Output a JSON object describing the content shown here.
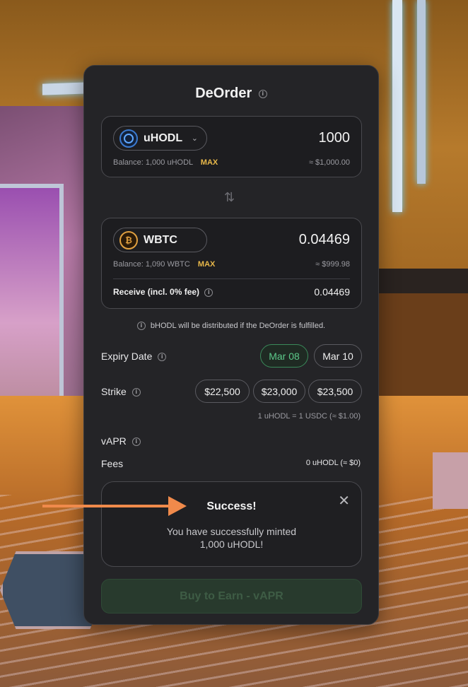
{
  "header": {
    "title": "DeOrder"
  },
  "from_token": {
    "symbol": "uHODL",
    "icon": "uhodl-token-icon",
    "amount": "1000",
    "balance": "Balance: 1,000 uHODL",
    "max_label": "MAX",
    "usd_value": "≈ $1,000.00"
  },
  "to_token": {
    "symbol": "WBTC",
    "icon": "bitcoin-token-icon",
    "amount": "0.04469",
    "balance": "Balance: 1,090 WBTC",
    "max_label": "MAX",
    "usd_value": "≈ $999.98",
    "receive_label": "Receive (incl. 0% fee)",
    "receive_value": "0.04469"
  },
  "notice": "bHODL will be distributed if the DeOrder is fulfilled.",
  "expiry": {
    "label": "Expiry Date",
    "options": [
      "Mar 08",
      "Mar 10"
    ],
    "selected": "Mar 08"
  },
  "strike": {
    "label": "Strike",
    "options": [
      "$22,500",
      "$23,000",
      "$23,500"
    ],
    "rate": "1 uHODL = 1 USDC (≈ $1.00)"
  },
  "vapr": {
    "label": "vAPR"
  },
  "fees": {
    "label": "Fees",
    "value": "0 uHODL (≈ $0)"
  },
  "toast": {
    "title": "Success!",
    "message_line1": "You have successfully minted",
    "message_line2": "1,000 uHODL!"
  },
  "buy_button": {
    "label": "Buy to Earn - vAPR"
  },
  "colors": {
    "accent_green": "#5cc98a",
    "max_yellow": "#e8b84a",
    "arrow_orange": "#f08a4b",
    "card_bg": "#242427"
  }
}
